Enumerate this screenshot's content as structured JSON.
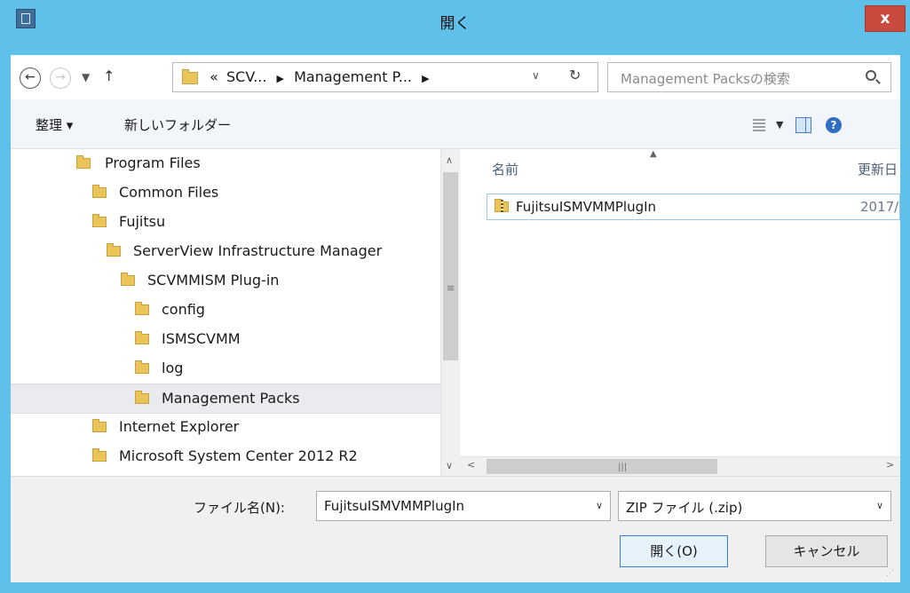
{
  "window": {
    "title": "開く",
    "close_glyph": "x"
  },
  "address": {
    "overflow": "«",
    "crumbs": [
      "SCV...",
      "Management P..."
    ],
    "search_placeholder": "Management Packsの検索"
  },
  "toolbar": {
    "organize_label": "整理 ▾",
    "new_folder_label": "新しいフォルダー"
  },
  "tree": {
    "items": [
      {
        "label": "Program Files",
        "indent": 0
      },
      {
        "label": "Common Files",
        "indent": 1
      },
      {
        "label": "Fujitsu",
        "indent": 1
      },
      {
        "label": "ServerView Infrastructure Manager",
        "indent": 2
      },
      {
        "label": "SCVMMISM Plug-in",
        "indent": 3
      },
      {
        "label": "config",
        "indent": 4
      },
      {
        "label": "ISMSCVMM",
        "indent": 4
      },
      {
        "label": "log",
        "indent": 4
      },
      {
        "label": "Management Packs",
        "indent": 4,
        "selected": true
      },
      {
        "label": "Internet Explorer",
        "indent": 1
      },
      {
        "label": "Microsoft System Center 2012 R2",
        "indent": 1
      }
    ]
  },
  "list": {
    "columns": {
      "name": "名前",
      "date": "更新日"
    },
    "files": [
      {
        "name": "FujitsuISMVMMPlugIn",
        "date": "2017/"
      }
    ]
  },
  "bottom": {
    "filename_label": "ファイル名(N):",
    "filename_value": "FujitsuISMVMMPlugIn",
    "filetype_value": "ZIP ファイル (.zip)",
    "open_label": "開く(O)",
    "cancel_label": "キャンセル"
  },
  "colors": {
    "titlebar": "#5fc0ea",
    "close": "#c94a3f",
    "selection": "#e9ebee",
    "folder": "#e8c45a"
  }
}
